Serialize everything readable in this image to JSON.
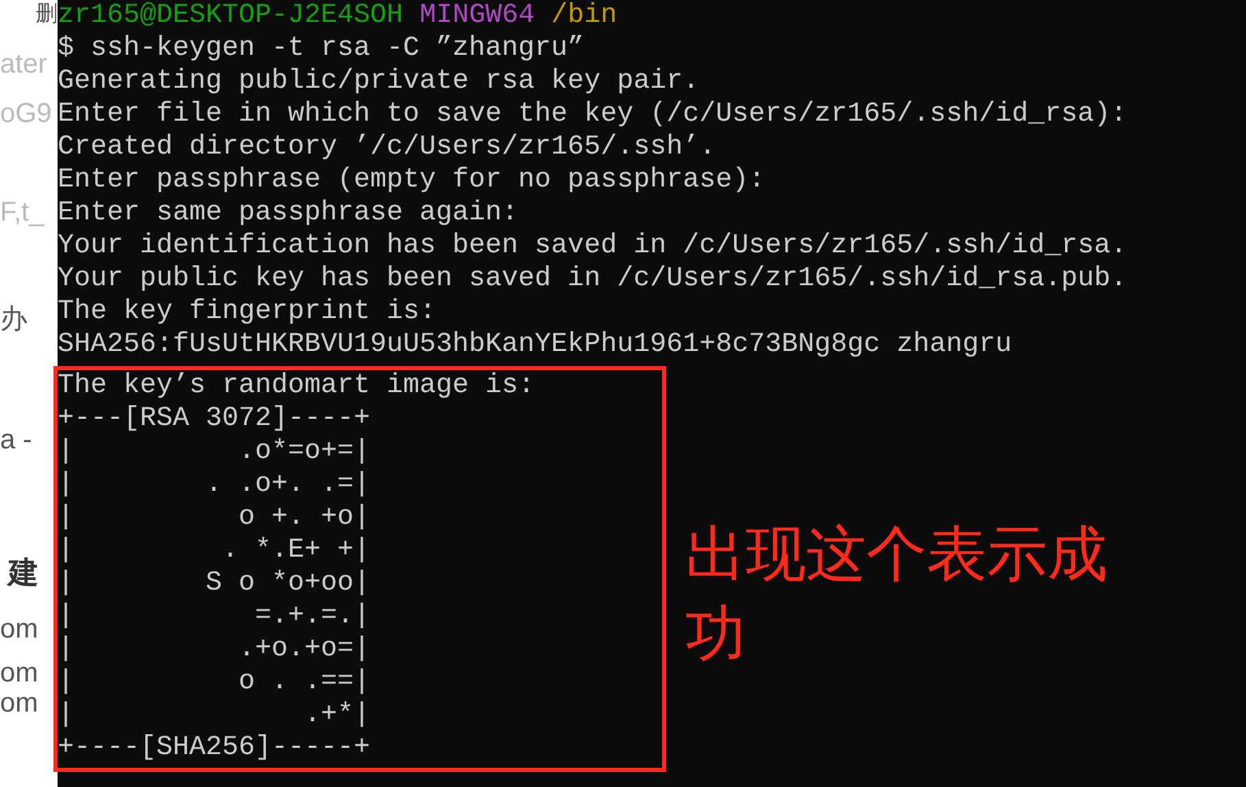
{
  "background_page": {
    "fragments": [
      {
        "text": "删",
        "kind": "small"
      },
      {
        "text": "ater",
        "kind": "faint"
      },
      {
        "text": "oG9",
        "kind": "faint"
      },
      {
        "text": "F,t_",
        "kind": "faint"
      },
      {
        "text": "办",
        "kind": "text"
      },
      {
        "text": "a -",
        "kind": "text"
      },
      {
        "text": "建",
        "kind": "heading"
      },
      {
        "text": "om",
        "kind": "text"
      },
      {
        "text": "om",
        "kind": "text"
      },
      {
        "text": "om",
        "kind": "text"
      }
    ]
  },
  "terminal": {
    "prompt": {
      "user_host": "zr165@DESKTOP-J2E4SOH",
      "shell": "MINGW64",
      "path": "/bin"
    },
    "command": "$ ssh-keygen -t rsa -C ”zhangru”",
    "output": [
      "Generating public/private rsa key pair.",
      "Enter file in which to save the key (/c/Users/zr165/.ssh/id_rsa):",
      "Created directory ’/c/Users/zr165/.ssh’.",
      "Enter passphrase (empty for no passphrase):",
      "Enter same passphrase again:",
      "Your identification has been saved in /c/Users/zr165/.ssh/id_rsa.",
      "Your public key has been saved in /c/Users/zr165/.ssh/id_rsa.pub.",
      "The key fingerprint is:",
      "SHA256:fUsUtHKRBVU19uU53hbKanYEkPhu1961+8c73BNg8gc zhangru"
    ],
    "randomart": [
      "The key’s randomart image is:",
      "+---[RSA 3072]----+",
      "|          .o*=o+=|",
      "|        . .o+. .=|",
      "|          o +. +o|",
      "|         . *.E+ +|",
      "|        S o *o+oo|",
      "|           =.+.=.|",
      "|          .+o.+o=|",
      "|          o . .==|",
      "|              .+*|",
      "+----[SHA256]-----+"
    ]
  },
  "annotation": {
    "text": "出现这个表示成功"
  }
}
